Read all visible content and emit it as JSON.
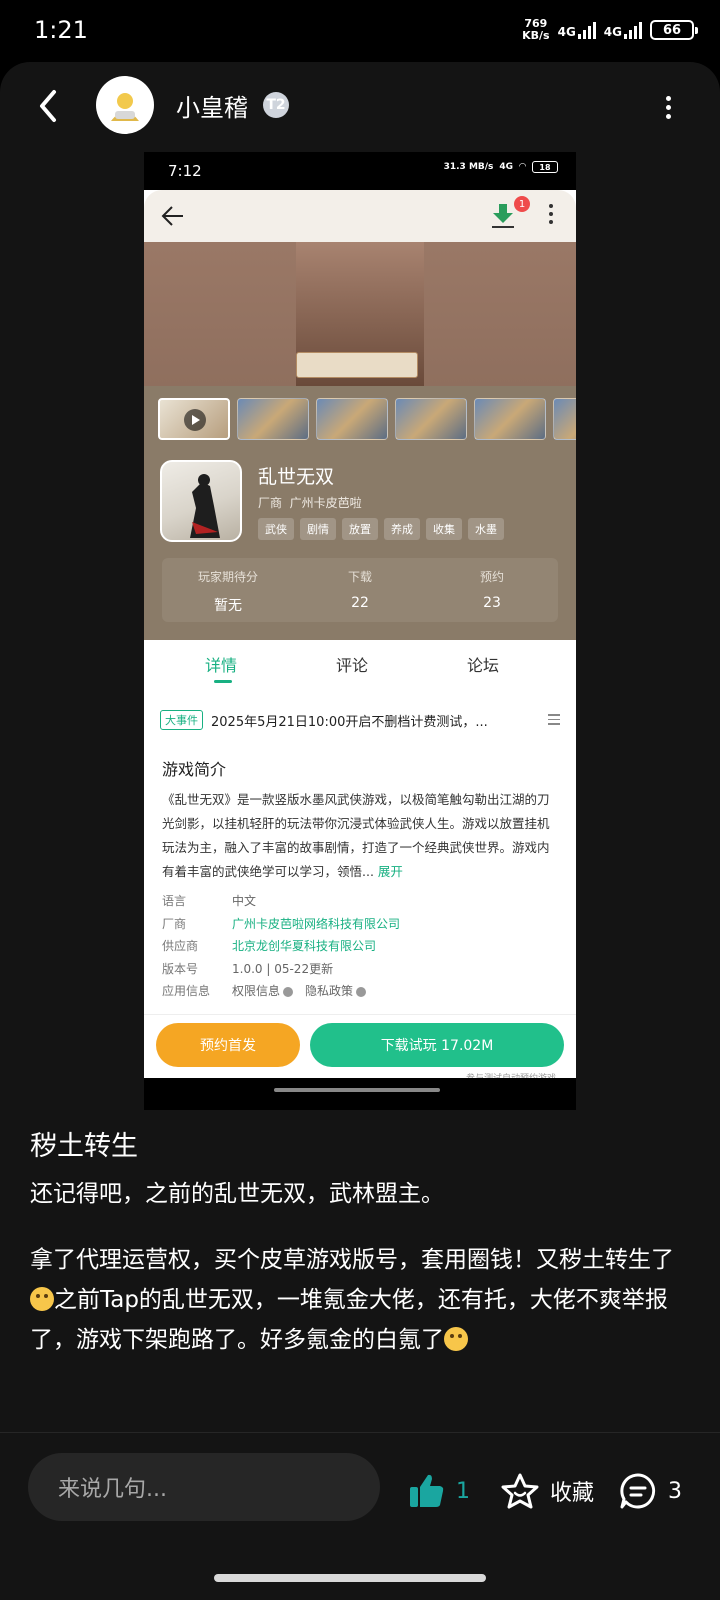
{
  "status_bar": {
    "time": "1:21",
    "speed_value": "769",
    "speed_unit": "KB/s",
    "net1": "4G",
    "net2": "4G",
    "battery": "66"
  },
  "header": {
    "username": "小皇稽",
    "level_badge": "T2"
  },
  "screenshot": {
    "status_time": "7:12",
    "status_speed": "31.3 MB/s",
    "status_net": "4G",
    "status_battery": "18",
    "download_badge": "1",
    "game_name": "乱世无双",
    "developer_label": "厂商",
    "developer": "广州卡皮芭啦",
    "tags": [
      "武侠",
      "剧情",
      "放置",
      "养成",
      "收集",
      "水墨"
    ],
    "stats": [
      {
        "label": "玩家期待分",
        "value": "暂无"
      },
      {
        "label": "下载",
        "value": "22"
      },
      {
        "label": "预约",
        "value": "23"
      }
    ],
    "tabs": [
      "详情",
      "评论",
      "论坛"
    ],
    "event_tag": "大事件",
    "event_text": "2025年5月21日10:00开启不删档计费测试，...",
    "intro_title": "游戏简介",
    "intro_text": "《乱世无双》是一款竖版水墨风武侠游戏，以极简笔触勾勒出江湖的刀光剑影，以挂机轻肝的玩法带你沉浸式体验武侠人生。游戏以放置挂机玩法为主，融入了丰富的故事剧情，打造了一个经典武侠世界。游戏内有着丰富的武侠绝学可以学习，领悟...",
    "expand": "展开",
    "info": [
      {
        "key": "语言",
        "value": "中文"
      },
      {
        "key": "厂商",
        "value": "广州卡皮芭啦网络科技有限公司"
      },
      {
        "key": "供应商",
        "value": "北京龙创华夏科技有限公司"
      },
      {
        "key": "版本号",
        "value": "1.0.0 | 05-22更新"
      }
    ],
    "app_info_label": "应用信息",
    "permission": "权限信息",
    "privacy": "隐私政策",
    "reserve_button": "预约首发",
    "download_button": "下载试玩 17.02M",
    "note": "参与测试自动预约游戏"
  },
  "post": {
    "title": "秽土转生",
    "p1": "还记得吧，之前的乱世无双，武林盟主。",
    "p2_a": "拿了代理运营权，买个皮草游戏版号，套用圈钱！又秽土转生了",
    "p2_b": "之前Tap的乱世无双，一堆氪金大佬，还有托，大佬不爽举报了，游戏下架跑路了。好多氪金的白氪了"
  },
  "bottom_bar": {
    "comment_placeholder": "来说几句...",
    "like_count": "1",
    "favorite_label": "收藏",
    "comment_count": "3"
  },
  "colors": {
    "accent_green": "#18b082",
    "like_teal": "#1aa6a0",
    "reserve_orange": "#f5a623"
  }
}
